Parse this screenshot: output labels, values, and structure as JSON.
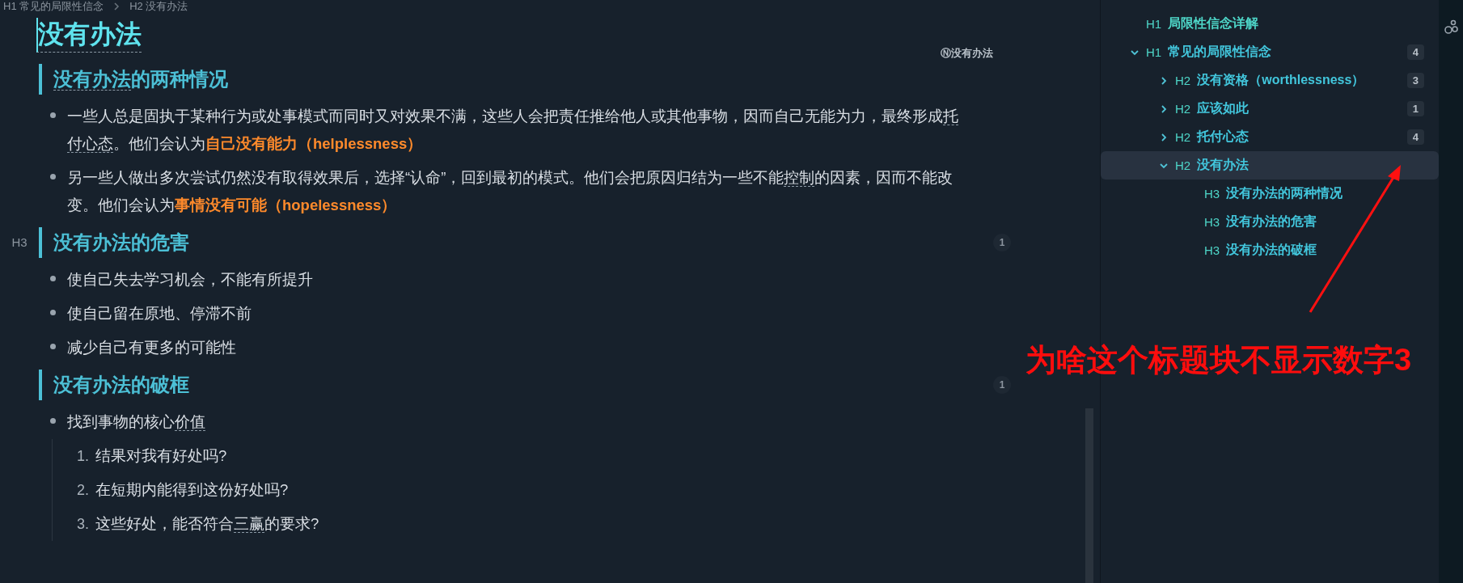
{
  "breadcrumb": [
    {
      "level": "H1",
      "text": "常见的局限性信念"
    },
    {
      "level": "H2",
      "text": "没有办法"
    }
  ],
  "document": {
    "title": "没有办法",
    "note_tag": "Ⓝ没有办法",
    "sections": [
      {
        "heading": [
          {
            "kind": "link",
            "text": "没有办法"
          },
          {
            "kind": "plain",
            "text": "的两种情况"
          }
        ],
        "items": [
          {
            "kind": "bullet",
            "segments": [
              {
                "kind": "plain",
                "text": "一些人总是固执于某种行为或处事模式而同时又对效果不满，这些人会把责任推给他人或其他事物，因而自己无能为力，最终形成"
              },
              {
                "kind": "link",
                "text": "托付心态"
              },
              {
                "kind": "plain",
                "text": "。他们会认为"
              },
              {
                "kind": "strong",
                "text": "自己没有能力（helplessness）"
              }
            ]
          },
          {
            "kind": "bullet",
            "segments": [
              {
                "kind": "plain",
                "text": "另一些人做出多次尝试仍然没有取得效果后，选择“认命”，回到最初的模式。他们会把原因归结为一些不能"
              },
              {
                "kind": "link",
                "text": "控制"
              },
              {
                "kind": "plain",
                "text": "的因素，因而不能改变。他们会认为"
              },
              {
                "kind": "strong",
                "text": "事情没有可能（hopelessness）"
              }
            ]
          }
        ]
      },
      {
        "heading": [
          {
            "kind": "plain",
            "text": "没有办法的危害"
          }
        ],
        "gutter_marker": "H3",
        "count": "1",
        "items": [
          {
            "kind": "bullet",
            "segments": [
              {
                "kind": "plain",
                "text": "使自己失去学习机会，不能有所提升"
              }
            ]
          },
          {
            "kind": "bullet",
            "segments": [
              {
                "kind": "plain",
                "text": "使自己留在原地、停滞不前"
              }
            ]
          },
          {
            "kind": "bullet",
            "segments": [
              {
                "kind": "plain",
                "text": "减少自己有更多的可能性"
              }
            ]
          }
        ]
      },
      {
        "heading": [
          {
            "kind": "plain",
            "text": "没有办法的破框"
          }
        ],
        "count": "1",
        "items": [
          {
            "kind": "bullet",
            "segments": [
              {
                "kind": "plain",
                "text": "找到事物的核心"
              },
              {
                "kind": "link",
                "text": "价值"
              }
            ],
            "children": [
              {
                "kind": "numbered",
                "number": "1.",
                "segments": [
                  {
                    "kind": "plain",
                    "text": "结果对我有好处吗?"
                  }
                ]
              },
              {
                "kind": "numbered",
                "number": "2.",
                "segments": [
                  {
                    "kind": "plain",
                    "text": "在短期内能得到这份好处吗?"
                  }
                ]
              },
              {
                "kind": "numbered",
                "number": "3.",
                "segments": [
                  {
                    "kind": "plain",
                    "text": "这些好处，能否符合"
                  },
                  {
                    "kind": "link",
                    "text": "三赢"
                  },
                  {
                    "kind": "plain",
                    "text": "的要求?"
                  }
                ]
              }
            ]
          }
        ]
      }
    ]
  },
  "outline": [
    {
      "level": "H1",
      "text": "局限性信念详解",
      "selected": false
    },
    {
      "level": "H1",
      "text": "常见的局限性信念",
      "count": "4",
      "expanded": true,
      "selected": false,
      "children": [
        {
          "level": "H2",
          "text": "没有资格（worthlessness）",
          "count": "3",
          "collapsible": true,
          "expanded": false,
          "selected": false
        },
        {
          "level": "H2",
          "text": "应该如此",
          "count": "1",
          "collapsible": true,
          "expanded": false,
          "selected": false
        },
        {
          "level": "H2",
          "text": "托付心态",
          "count": "4",
          "collapsible": true,
          "expanded": false,
          "selected": false
        },
        {
          "level": "H2",
          "text": "没有办法",
          "expanded": true,
          "selected": true,
          "children": [
            {
              "level": "H3",
              "text": "没有办法的两种情况",
              "selected": false
            },
            {
              "level": "H3",
              "text": "没有办法的危害",
              "selected": false
            },
            {
              "level": "H3",
              "text": "没有办法的破框",
              "selected": false
            }
          ]
        }
      ]
    }
  ],
  "annotation": {
    "text": "为啥这个标题块不显示数字3"
  }
}
